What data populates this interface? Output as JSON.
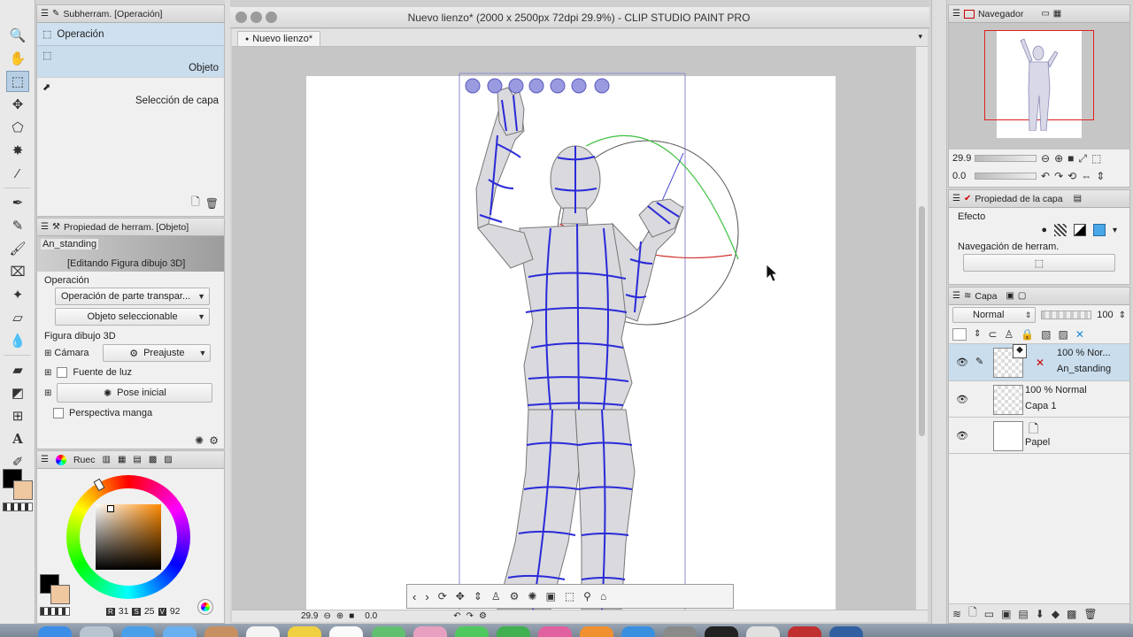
{
  "window": {
    "title": "Nuevo lienzo* (2000 x 2500px 72dpi 29.9%) - CLIP STUDIO PAINT PRO",
    "tab": "Nuevo lienzo*"
  },
  "subtool": {
    "header": "Subherram. [Operación]",
    "tab_label": "Operación",
    "items": [
      {
        "label": "Objeto"
      },
      {
        "label": "Selección de capa"
      }
    ]
  },
  "tool_property": {
    "header": "Propiedad de herram. [Objeto]",
    "object_name": "An_standing",
    "editing_label": "[Editando Figura dibujo 3D]",
    "operation_label": "Operación",
    "operation_select": "Operación de parte transpar...",
    "object_select": "Objeto seleccionable",
    "figure_label": "Figura dibujo 3D",
    "camera_label": "Cámara",
    "preset_label": "Preajuste",
    "light_label": "Fuente de luz",
    "pose_label": "Pose inicial",
    "manga_label": "Perspectiva manga"
  },
  "color": {
    "tab_label": "Ruec",
    "r": "31",
    "g": "25",
    "b": "92",
    "r_label": "R",
    "g_label": "S",
    "b_label": "V",
    "main_color": "#000000",
    "sub_color": "#f0c8a0"
  },
  "navigator": {
    "header": "Navegador",
    "zoom": "29.9",
    "rotation": "0.0"
  },
  "layer_property": {
    "header": "Propiedad de la capa",
    "effect_label": "Efecto",
    "nav_label": "Navegación de herram."
  },
  "layers": {
    "header": "Capa",
    "blend_mode": "Normal",
    "opacity": "100",
    "items": [
      {
        "top": "100 % Nor...",
        "bottom": "An_standing"
      },
      {
        "top": "100 % Normal",
        "bottom": "Capa 1"
      },
      {
        "top": "",
        "bottom": "Papel"
      }
    ]
  },
  "status": {
    "zoom": "29.9",
    "rotation": "0.0"
  }
}
